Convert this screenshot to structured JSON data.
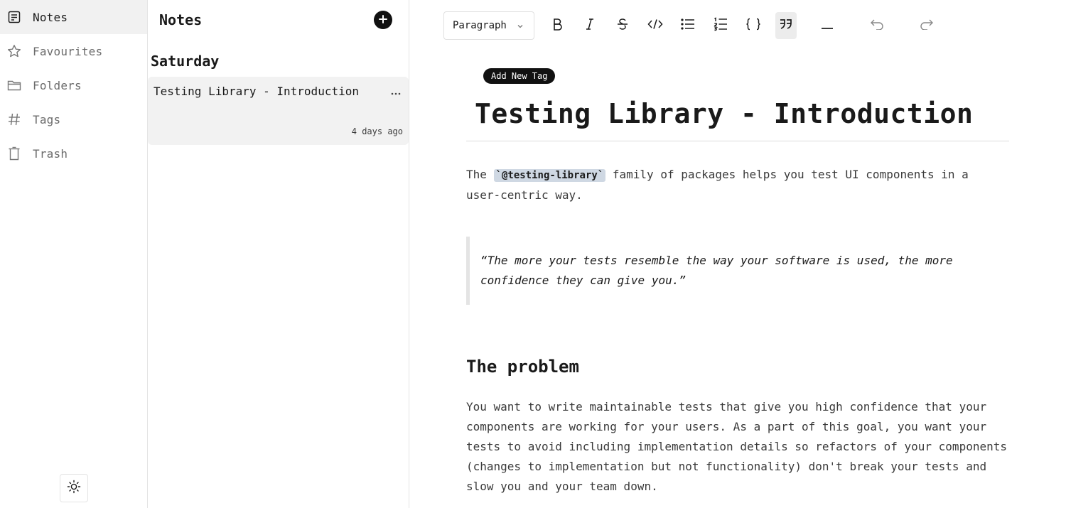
{
  "sidebar": {
    "items": [
      {
        "label": "Notes",
        "icon": "notes-icon",
        "active": true
      },
      {
        "label": "Favourites",
        "icon": "star-icon"
      },
      {
        "label": "Folders",
        "icon": "folder-icon"
      },
      {
        "label": "Tags",
        "icon": "hash-icon"
      },
      {
        "label": "Trash",
        "icon": "trash-icon"
      }
    ],
    "theme_icon": "sun-icon"
  },
  "notes_list": {
    "header": "Notes",
    "group_title": "Saturday",
    "note": {
      "title": "Testing Library - Introduction",
      "time": "4 days ago"
    }
  },
  "toolbar": {
    "block_type": "Paragraph",
    "buttons": [
      "bold-icon",
      "italic-icon",
      "strikethrough-icon",
      "code-icon",
      "bullet-list-icon",
      "numbered-list-icon",
      "code-block-icon",
      "blockquote-icon",
      "horizontal-rule-icon",
      "undo-icon",
      "redo-icon"
    ],
    "active_button": "blockquote-icon"
  },
  "editor": {
    "tag_button": "Add New Tag",
    "title": "Testing Library - Introduction",
    "intro_before": "The ",
    "intro_code": "`@testing-library`",
    "intro_after": " family of packages helps you test UI components in a user-centric way.",
    "quote": "“The more your tests resemble the way your software is used, the more confidence they can give you.”",
    "heading": "The problem",
    "problem_text": "You want to write maintainable tests that give you high confidence that your components are working for your users. As a part of this goal, you want your tests to avoid including implementation details so refactors of your components (changes to implementation but not functionality) don't break your tests and slow you and your team down."
  },
  "colors": {
    "accent": "#111111",
    "active_bg": "#f1f1f1",
    "code_bg": "#cfd8e3"
  }
}
